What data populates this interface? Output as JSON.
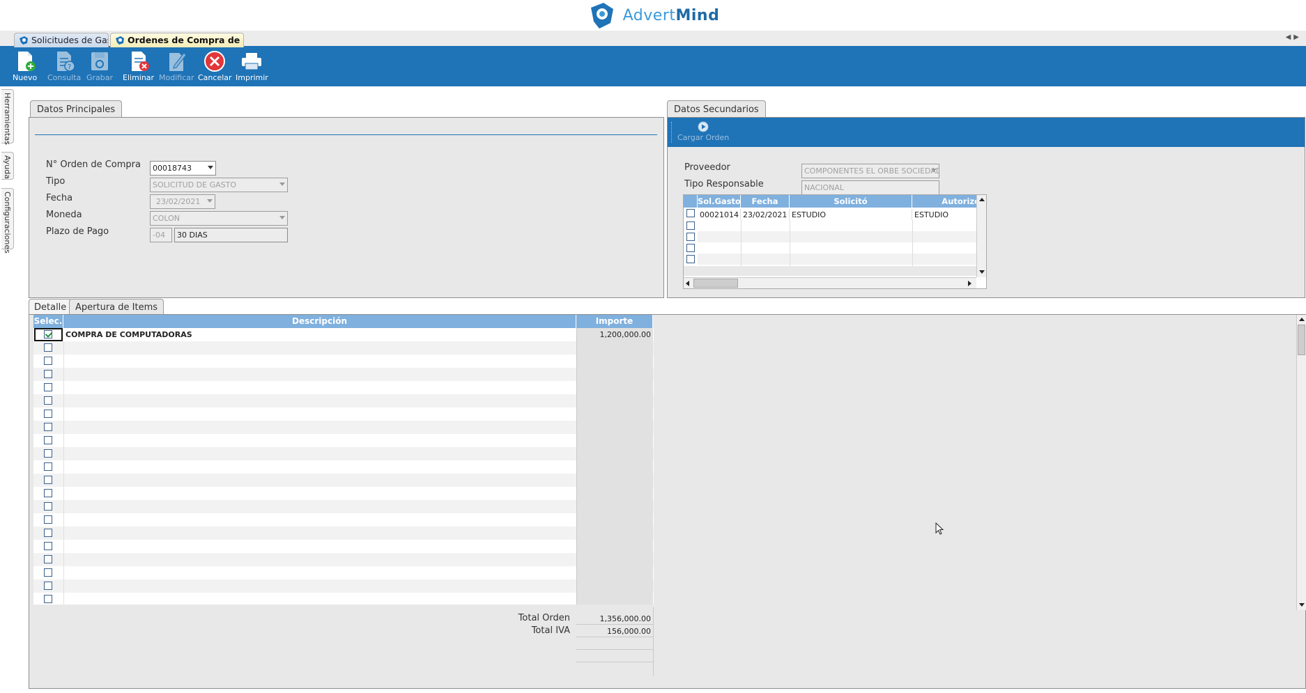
{
  "brand": {
    "name_light": "Advert",
    "name_bold": "Mind"
  },
  "doc_tabs": [
    {
      "label": "Solicitudes de Gastos"
    },
    {
      "label": "Ordenes de Compra de Gastos"
    }
  ],
  "toolbar": {
    "buttons": [
      {
        "label": "Nuevo",
        "icon": "new-document-icon",
        "enabled": true
      },
      {
        "label": "Consulta",
        "icon": "query-document-icon",
        "enabled": false
      },
      {
        "label": "Grabar",
        "icon": "save-disk-icon",
        "enabled": false
      },
      {
        "label": "Eliminar",
        "icon": "delete-document-icon",
        "enabled": true
      },
      {
        "label": "Modificar",
        "icon": "edit-document-icon",
        "enabled": false
      },
      {
        "label": "Cancelar",
        "icon": "cancel-icon",
        "enabled": true
      },
      {
        "label": "Imprimir",
        "icon": "printer-icon",
        "enabled": true
      }
    ]
  },
  "side_rail": {
    "tabs": [
      "Herramientas",
      "Ayuda",
      "Configuraciones"
    ]
  },
  "datos_principales": {
    "tab_label": "Datos Principales",
    "fields": {
      "orden_label": "N° Orden de Compra",
      "orden_value": "00018743",
      "tipo_label": "Tipo",
      "tipo_value": "SOLICITUD DE GASTO",
      "fecha_label": "Fecha",
      "fecha_value": "23/02/2021",
      "moneda_label": "Moneda",
      "moneda_value": "COLON",
      "plazo_label": "Plazo de Pago",
      "plazo_code": "-04",
      "plazo_value": "30 DIAS"
    }
  },
  "datos_secundarios": {
    "tab_label": "Datos Secundarios",
    "cargar_label": "Cargar Orden",
    "proveedor_label": "Proveedor",
    "proveedor_value": "COMPONENTES EL ORBE SOCIEDAD ANONIMA",
    "tipo_resp_label": "Tipo Responsable",
    "tipo_resp_value": "NACIONAL",
    "grid": {
      "headers": [
        "Sol.Gasto",
        "Fecha",
        "Solicitó",
        "Autorizó"
      ],
      "rows": [
        {
          "sol": "00021014",
          "fecha": "23/02/2021",
          "solicito": "ESTUDIO",
          "autorizo": "ESTUDIO"
        }
      ]
    }
  },
  "detail_tabs": {
    "detalle": "Detalle",
    "apertura": "Apertura de Items"
  },
  "detail_grid": {
    "headers": {
      "sel": "Selec.",
      "desc": "Descripción",
      "imp": "Importe"
    },
    "rows": [
      {
        "checked": true,
        "desc": "COMPRA DE COMPUTADORAS",
        "imp": "1,200,000.00"
      }
    ]
  },
  "totals": {
    "orden_label": "Total Orden",
    "orden_value": "1,356,000.00",
    "iva_label": "Total IVA",
    "iva_value": "156,000.00"
  },
  "colors": {
    "accent": "#1f73b7",
    "grid_header": "#7fb0de",
    "panel_bg": "#e8e8e8"
  }
}
